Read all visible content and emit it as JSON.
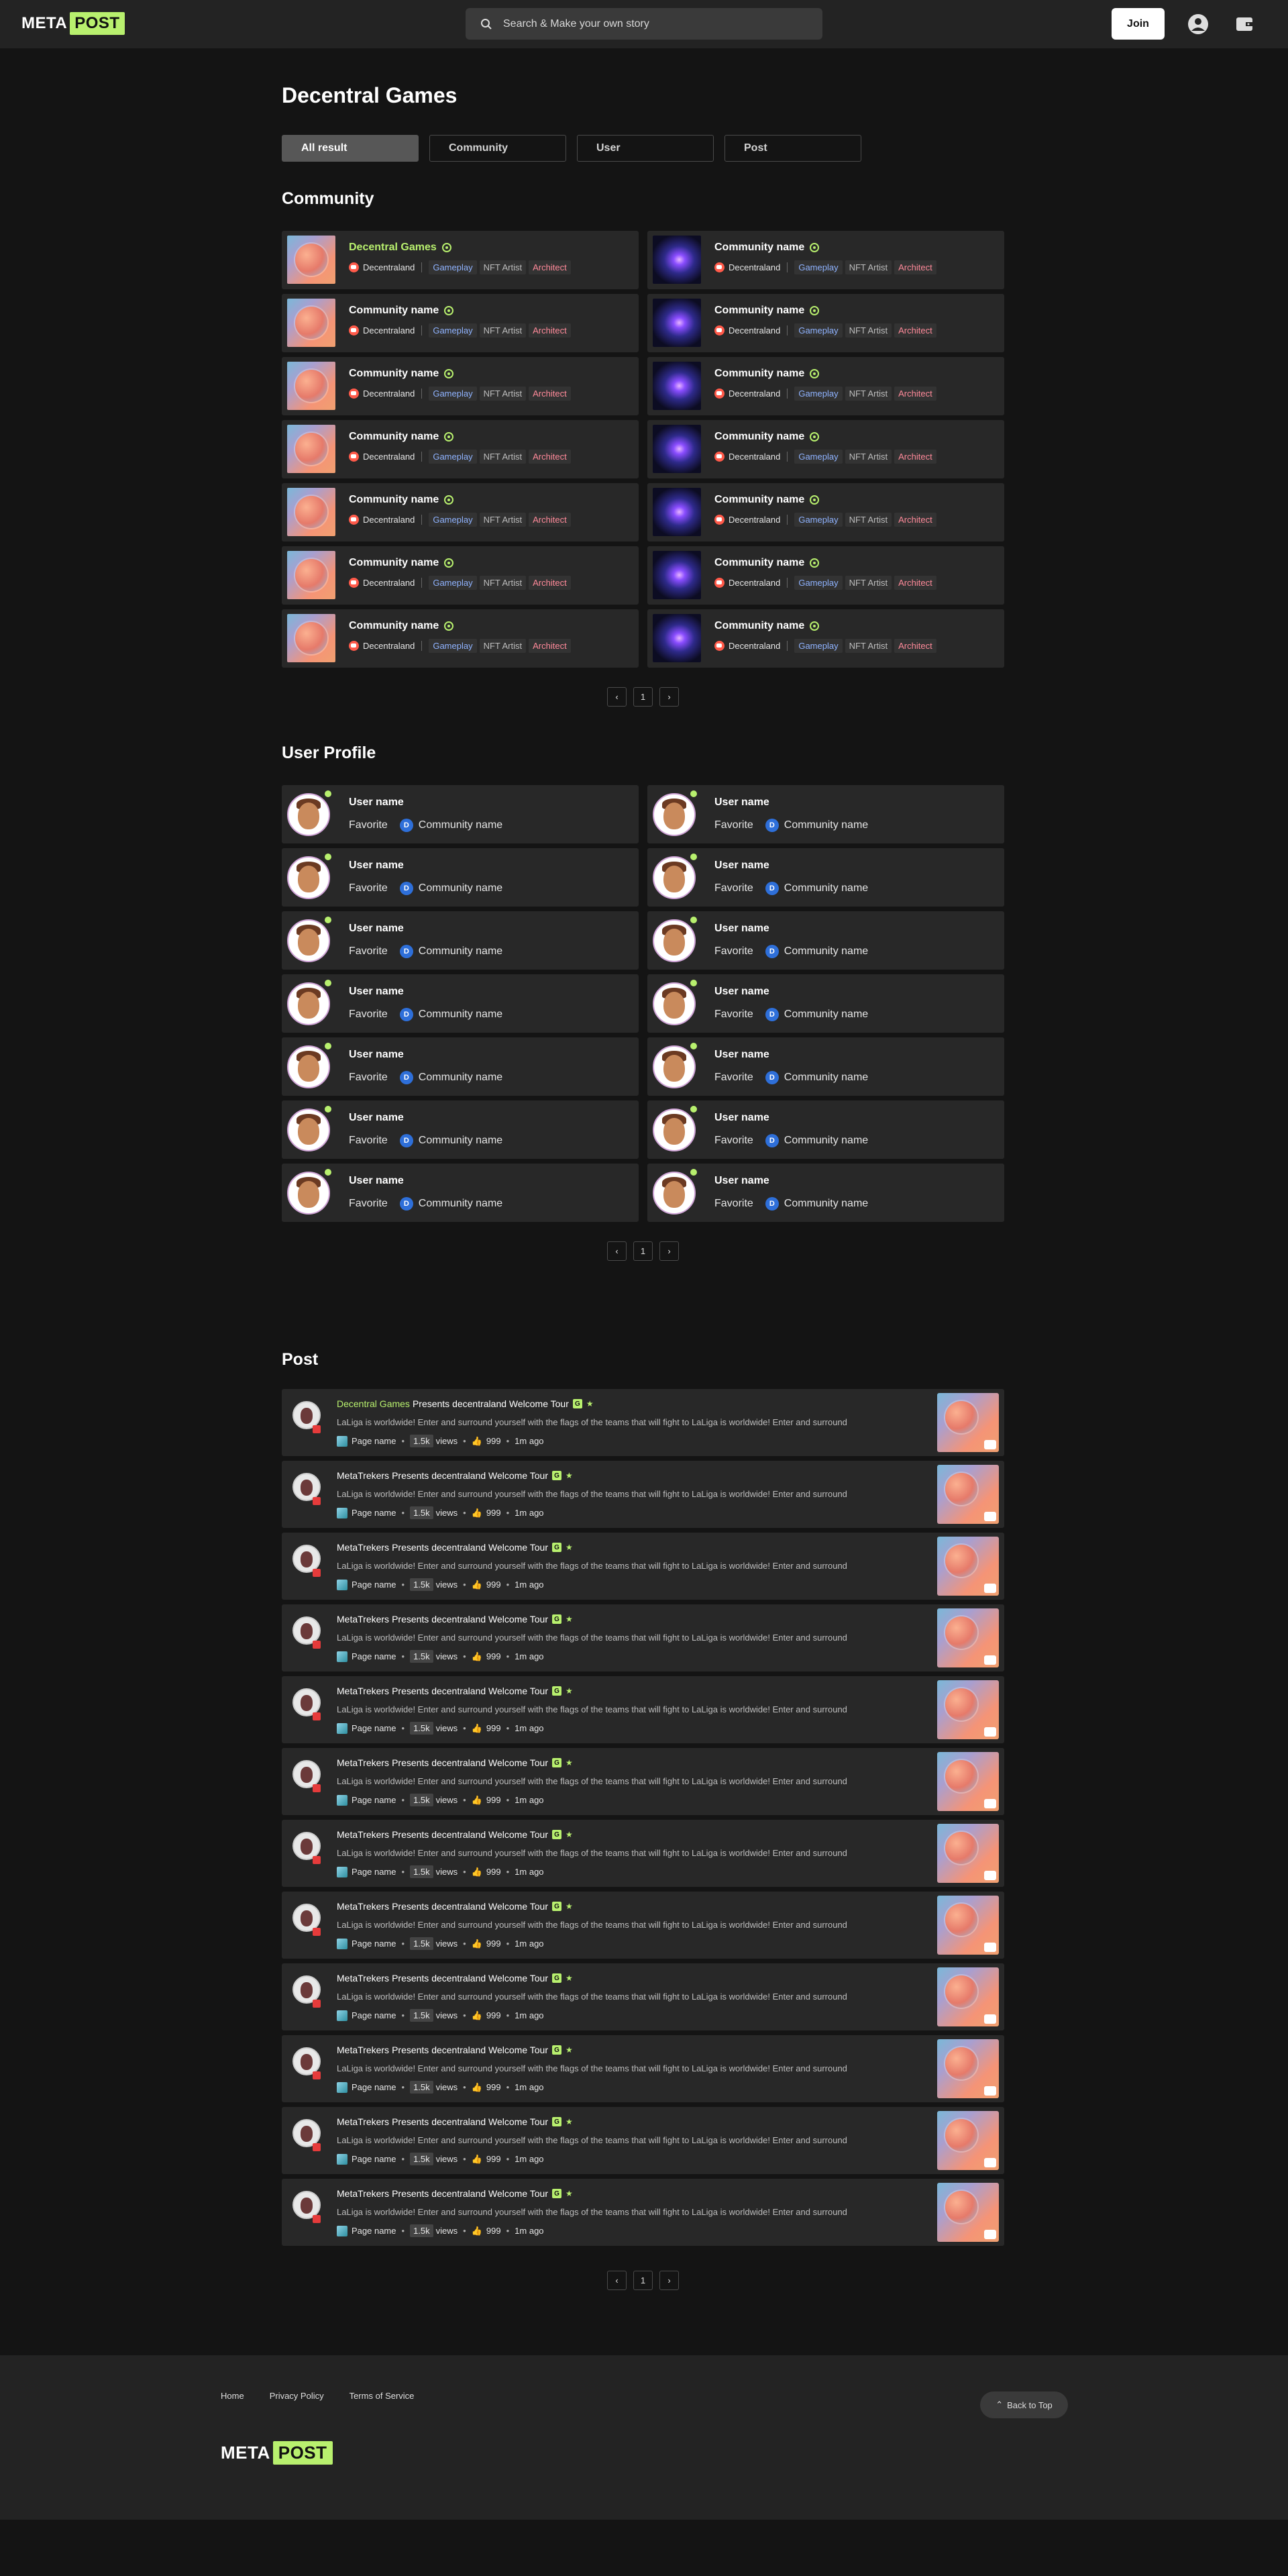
{
  "header": {
    "logo_meta": "META",
    "logo_post": "POST",
    "search_placeholder": "Search & Make your own story",
    "join_label": "Join",
    "icons": [
      "user-circle-icon",
      "wallet-icon"
    ]
  },
  "page_title": "Decentral Games",
  "tabs": [
    {
      "label": "All result",
      "active": true
    },
    {
      "label": "Community"
    },
    {
      "label": "User"
    },
    {
      "label": "Post"
    }
  ],
  "community": {
    "title": "Community",
    "left": [
      {
        "name": "Decentral Games",
        "highlight": true,
        "platform": "Decentraland",
        "tags": [
          "Gameplay",
          "NFT Artist",
          "Architect"
        ]
      },
      {
        "name": "Community name",
        "platform": "Decentraland",
        "tags": [
          "Gameplay",
          "NFT Artist",
          "Architect"
        ]
      },
      {
        "name": "Community name",
        "platform": "Decentraland",
        "tags": [
          "Gameplay",
          "NFT Artist",
          "Architect"
        ]
      },
      {
        "name": "Community name",
        "platform": "Decentraland",
        "tags": [
          "Gameplay",
          "NFT Artist",
          "Architect"
        ]
      },
      {
        "name": "Community name",
        "platform": "Decentraland",
        "tags": [
          "Gameplay",
          "NFT Artist",
          "Architect"
        ]
      },
      {
        "name": "Community name",
        "platform": "Decentraland",
        "tags": [
          "Gameplay",
          "NFT Artist",
          "Architect"
        ]
      },
      {
        "name": "Community name",
        "platform": "Decentraland",
        "tags": [
          "Gameplay",
          "NFT Artist",
          "Architect"
        ]
      }
    ],
    "right": [
      {
        "name": "Community name",
        "platform": "Decentraland",
        "tags": [
          "Gameplay",
          "NFT Artist",
          "Architect"
        ]
      },
      {
        "name": "Community name",
        "platform": "Decentraland",
        "tags": [
          "Gameplay",
          "NFT Artist",
          "Architect"
        ]
      },
      {
        "name": "Community name",
        "platform": "Decentraland",
        "tags": [
          "Gameplay",
          "NFT Artist",
          "Architect"
        ]
      },
      {
        "name": "Community name",
        "platform": "Decentraland",
        "tags": [
          "Gameplay",
          "NFT Artist",
          "Architect"
        ]
      },
      {
        "name": "Community name",
        "platform": "Decentraland",
        "tags": [
          "Gameplay",
          "NFT Artist",
          "Architect"
        ]
      },
      {
        "name": "Community name",
        "platform": "Decentraland",
        "tags": [
          "Gameplay",
          "NFT Artist",
          "Architect"
        ]
      },
      {
        "name": "Community name",
        "platform": "Decentraland",
        "tags": [
          "Gameplay",
          "NFT Artist",
          "Architect"
        ]
      }
    ],
    "page": "1"
  },
  "users": {
    "title": "User Profile",
    "items": [
      {
        "name": "User name",
        "favorite": "Favorite",
        "community": "Community name"
      },
      {
        "name": "User name",
        "favorite": "Favorite",
        "community": "Community name"
      },
      {
        "name": "User name",
        "favorite": "Favorite",
        "community": "Community name"
      },
      {
        "name": "User name",
        "favorite": "Favorite",
        "community": "Community name"
      },
      {
        "name": "User name",
        "favorite": "Favorite",
        "community": "Community name"
      },
      {
        "name": "User name",
        "favorite": "Favorite",
        "community": "Community name"
      },
      {
        "name": "User name",
        "favorite": "Favorite",
        "community": "Community name"
      },
      {
        "name": "User name",
        "favorite": "Favorite",
        "community": "Community name"
      },
      {
        "name": "User name",
        "favorite": "Favorite",
        "community": "Community name"
      },
      {
        "name": "User name",
        "favorite": "Favorite",
        "community": "Community name"
      },
      {
        "name": "User name",
        "favorite": "Favorite",
        "community": "Community name"
      },
      {
        "name": "User name",
        "favorite": "Favorite",
        "community": "Community name"
      },
      {
        "name": "User name",
        "favorite": "Favorite",
        "community": "Community name"
      },
      {
        "name": "User name",
        "favorite": "Favorite",
        "community": "Community name"
      }
    ],
    "page": "1"
  },
  "posts": {
    "title": "Post",
    "items": [
      {
        "author": "Decentral Games",
        "highlight": true,
        "title": "Presents decentraland Welcome Tour",
        "body": "LaLiga is worldwide! Enter and surround yourself with the flags of the teams that will fight to LaLiga is worldwide! Enter and surround",
        "page": "Page name",
        "views": "1.5k",
        "views_label": "views",
        "likes": "999",
        "time": "1m ago"
      },
      {
        "author": "MetaTrekers",
        "title": "Presents decentraland Welcome Tour",
        "body": "LaLiga is worldwide! Enter and surround yourself with the flags of the teams that will fight to LaLiga is worldwide! Enter and surround",
        "page": "Page name",
        "views": "1.5k",
        "views_label": "views",
        "likes": "999",
        "time": "1m ago"
      },
      {
        "author": "MetaTrekers",
        "title": "Presents decentraland Welcome Tour",
        "body": "LaLiga is worldwide! Enter and surround yourself with the flags of the teams that will fight to LaLiga is worldwide! Enter and surround",
        "page": "Page name",
        "views": "1.5k",
        "views_label": "views",
        "likes": "999",
        "time": "1m ago"
      },
      {
        "author": "MetaTrekers",
        "title": "Presents decentraland Welcome Tour",
        "body": "LaLiga is worldwide! Enter and surround yourself with the flags of the teams that will fight to LaLiga is worldwide! Enter and surround",
        "page": "Page name",
        "views": "1.5k",
        "views_label": "views",
        "likes": "999",
        "time": "1m ago"
      },
      {
        "author": "MetaTrekers",
        "title": "Presents decentraland Welcome Tour",
        "body": "LaLiga is worldwide! Enter and surround yourself with the flags of the teams that will fight to LaLiga is worldwide! Enter and surround",
        "page": "Page name",
        "views": "1.5k",
        "views_label": "views",
        "likes": "999",
        "time": "1m ago"
      },
      {
        "author": "MetaTrekers",
        "title": "Presents decentraland Welcome Tour",
        "body": "LaLiga is worldwide! Enter and surround yourself with the flags of the teams that will fight to LaLiga is worldwide! Enter and surround",
        "page": "Page name",
        "views": "1.5k",
        "views_label": "views",
        "likes": "999",
        "time": "1m ago"
      },
      {
        "author": "MetaTrekers",
        "title": "Presents decentraland Welcome Tour",
        "body": "LaLiga is worldwide! Enter and surround yourself with the flags of the teams that will fight to LaLiga is worldwide! Enter and surround",
        "page": "Page name",
        "views": "1.5k",
        "views_label": "views",
        "likes": "999",
        "time": "1m ago"
      },
      {
        "author": "MetaTrekers",
        "title": "Presents decentraland Welcome Tour",
        "body": "LaLiga is worldwide! Enter and surround yourself with the flags of the teams that will fight to LaLiga is worldwide! Enter and surround",
        "page": "Page name",
        "views": "1.5k",
        "views_label": "views",
        "likes": "999",
        "time": "1m ago"
      },
      {
        "author": "MetaTrekers",
        "title": "Presents decentraland Welcome Tour",
        "body": "LaLiga is worldwide! Enter and surround yourself with the flags of the teams that will fight to LaLiga is worldwide! Enter and surround",
        "page": "Page name",
        "views": "1.5k",
        "views_label": "views",
        "likes": "999",
        "time": "1m ago"
      },
      {
        "author": "MetaTrekers",
        "title": "Presents decentraland Welcome Tour",
        "body": "LaLiga is worldwide! Enter and surround yourself with the flags of the teams that will fight to LaLiga is worldwide! Enter and surround",
        "page": "Page name",
        "views": "1.5k",
        "views_label": "views",
        "likes": "999",
        "time": "1m ago"
      },
      {
        "author": "MetaTrekers",
        "title": "Presents decentraland Welcome Tour",
        "body": "LaLiga is worldwide! Enter and surround yourself with the flags of the teams that will fight to LaLiga is worldwide! Enter and surround",
        "page": "Page name",
        "views": "1.5k",
        "views_label": "views",
        "likes": "999",
        "time": "1m ago"
      },
      {
        "author": "MetaTrekers",
        "title": "Presents decentraland Welcome Tour",
        "body": "LaLiga is worldwide! Enter and surround yourself with the flags of the teams that will fight to LaLiga is worldwide! Enter and surround",
        "page": "Page name",
        "views": "1.5k",
        "views_label": "views",
        "likes": "999",
        "time": "1m ago"
      }
    ],
    "page": "1"
  },
  "footer": {
    "links": [
      "Home",
      "Privacy Policy",
      "Terms of Service"
    ],
    "back_to_top": "Back to Top",
    "logo_meta": "META",
    "logo_post": "POST"
  },
  "colors": {
    "accent": "#b8f06e",
    "background": "#141414",
    "card": "#282828",
    "header": "#232323"
  }
}
